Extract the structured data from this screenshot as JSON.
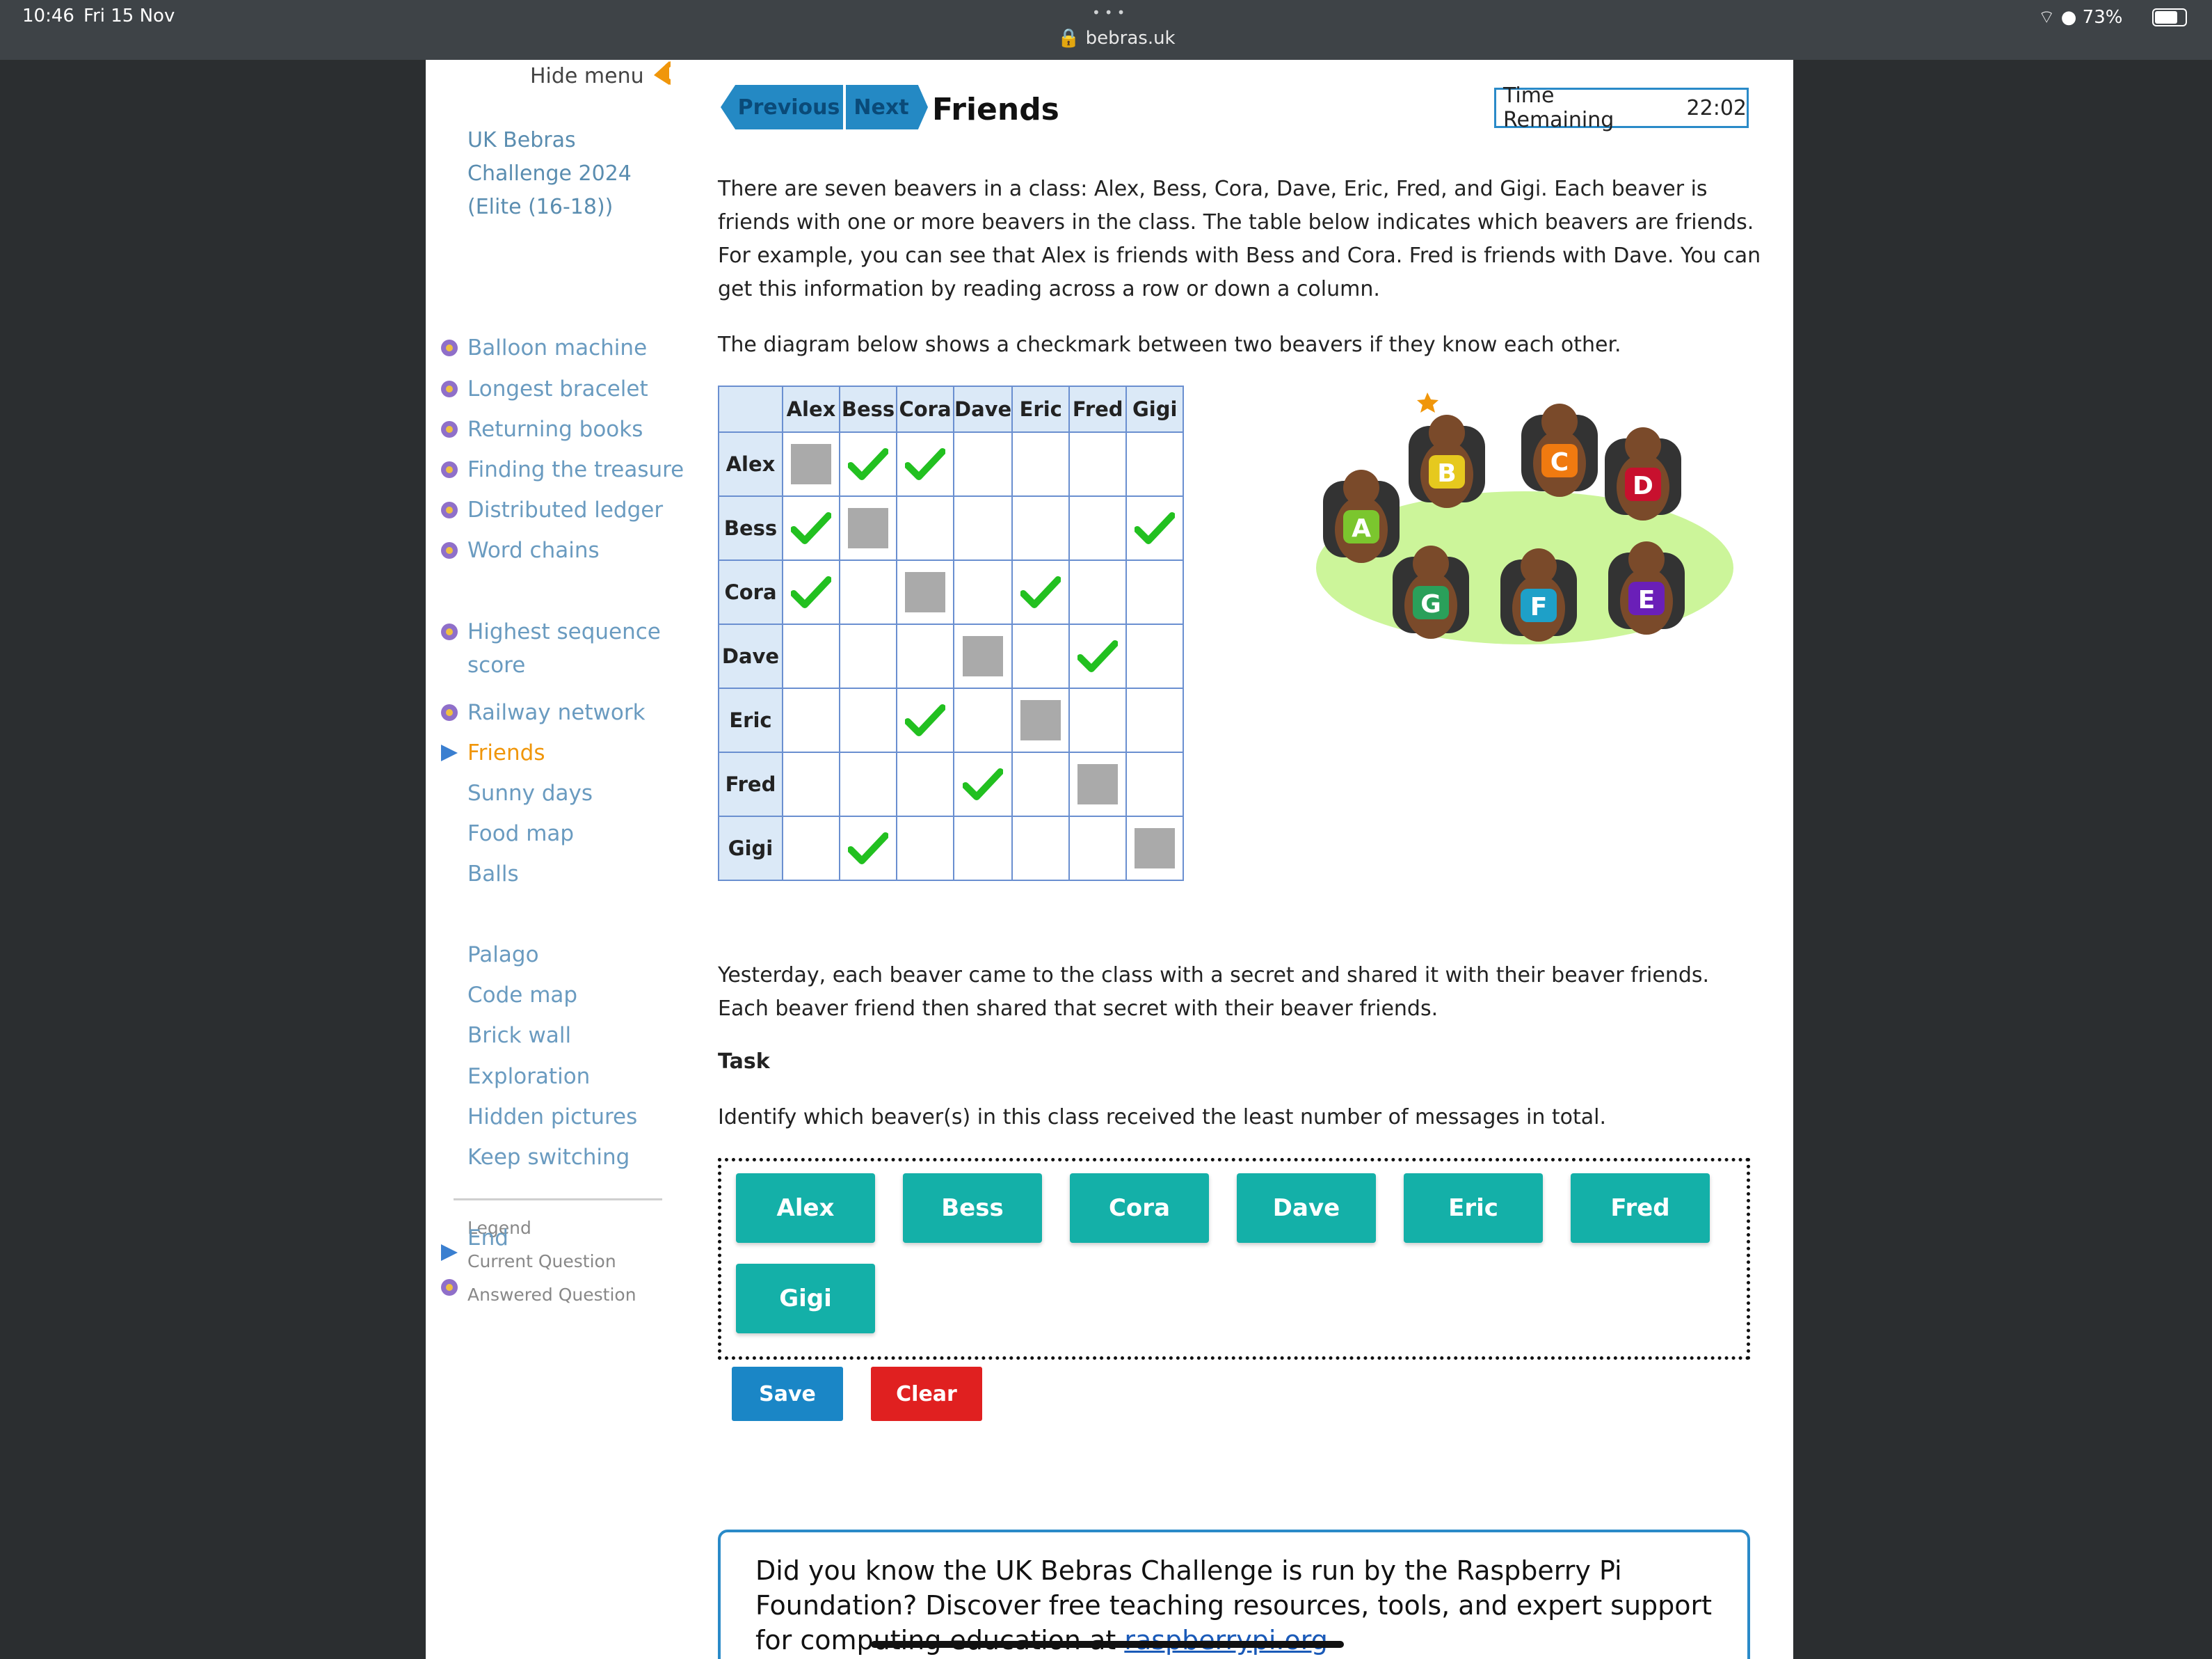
{
  "status_bar": {
    "time": "10:46",
    "date": "Fri 15 Nov",
    "url": "bebras.uk",
    "battery": "73%"
  },
  "sidebar": {
    "hide_menu": "Hide menu",
    "title": "UK Bebras Challenge 2024 (Elite (16-18))",
    "items": [
      {
        "label": "Balloon machine",
        "state": "answered"
      },
      {
        "label": "Longest bracelet",
        "state": "answered"
      },
      {
        "label": "Returning books",
        "state": "answered"
      },
      {
        "label": "Finding the treasure",
        "state": "answered"
      },
      {
        "label": "Distributed ledger",
        "state": "answered"
      },
      {
        "label": "Word chains",
        "state": "answered"
      },
      {
        "label": "Highest sequence",
        "state": "answered"
      },
      {
        "label": "Railway network",
        "state": "answered"
      },
      {
        "label": "Friends",
        "state": "current"
      },
      {
        "label": "Sunny days",
        "state": "none"
      },
      {
        "label": "Food map",
        "state": "none"
      },
      {
        "label": "Balls",
        "state": "none"
      },
      {
        "label": "Palago",
        "state": "none"
      },
      {
        "label": "Code map",
        "state": "none"
      },
      {
        "label": "Brick wall",
        "state": "none"
      },
      {
        "label": "Exploration",
        "state": "none"
      },
      {
        "label": "Hidden pictures",
        "state": "none"
      },
      {
        "label": "Keep switching",
        "state": "none"
      },
      {
        "label": "End",
        "state": "none"
      }
    ],
    "sequence_line2": "score",
    "legend": {
      "title": "Legend",
      "current": "Current Question",
      "answered": "Answered Question"
    }
  },
  "header": {
    "previous": "Previous",
    "next": "Next",
    "title": "Friends",
    "time_label": "Time Remaining",
    "time_value": "22:02"
  },
  "intro": {
    "p1": "There are seven beavers in a class: Alex, Bess, Cora, Dave, Eric, Fred, and Gigi. Each beaver is friends with one or more beavers in the class. The table below indicates which  beavers are friends. For example, you can see that Alex is friends with Bess and Cora. Fred is friends with Dave. You can get this information by reading across a row or down a column.",
    "p2": "The diagram below shows a checkmark between two beavers if they know each other."
  },
  "table": {
    "names": [
      "Alex",
      "Bess",
      "Cora",
      "Dave",
      "Eric",
      "Fred",
      "Gigi"
    ],
    "matrix": [
      [
        "x",
        "c",
        "c",
        "",
        "",
        "",
        ""
      ],
      [
        "c",
        "x",
        "",
        "",
        "",
        "",
        "c"
      ],
      [
        "c",
        "",
        "x",
        "",
        "c",
        "",
        ""
      ],
      [
        "",
        "",
        "",
        "x",
        "",
        "c",
        ""
      ],
      [
        "",
        "",
        "c",
        "",
        "x",
        "",
        ""
      ],
      [
        "",
        "",
        "",
        "c",
        "",
        "x",
        ""
      ],
      [
        "",
        "c",
        "",
        "",
        "",
        "",
        "x"
      ]
    ]
  },
  "illustration": {
    "letters": [
      "A",
      "B",
      "C",
      "D",
      "E",
      "F",
      "G"
    ]
  },
  "body": {
    "p3": "Yesterday, each beaver came to the class with a secret and shared it with their beaver friends. Each beaver friend then shared that secret with their beaver friends.",
    "task_label": "Task",
    "task": "Identify which beaver(s) in this class received the least number of messages in total."
  },
  "options": [
    "Alex",
    "Bess",
    "Cora",
    "Dave",
    "Eric",
    "Fred",
    "Gigi"
  ],
  "actions": {
    "save": "Save",
    "clear": "Clear"
  },
  "promo": {
    "text": "Did you know the UK Bebras Challenge is run by the Raspberry Pi Foundation? Discover free teaching resources, tools, and expert support for computing education at ",
    "link": "raspberrypi.org"
  },
  "colors": {
    "accent": "#2489c4",
    "option": "#14b0a8",
    "clear": "#e02020",
    "current": "#f0960a"
  }
}
